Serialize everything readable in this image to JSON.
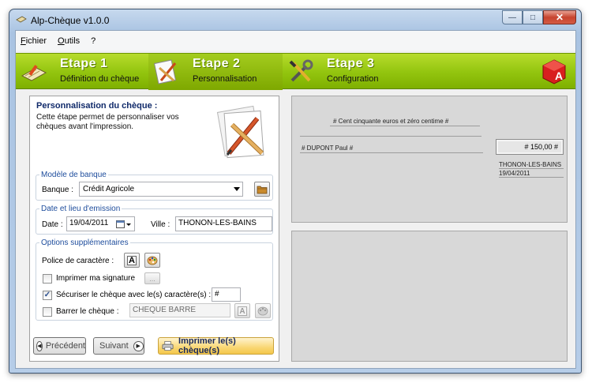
{
  "window": {
    "title": "Alp-Chèque v1.0.0"
  },
  "menu": [
    "Fichier",
    "Outils",
    "?"
  ],
  "steps": [
    {
      "title": "Etape 1",
      "subtitle": "Définition du chèque"
    },
    {
      "title": "Etape 2",
      "subtitle": "Personnalisation"
    },
    {
      "title": "Etape 3",
      "subtitle": "Configuration"
    }
  ],
  "panel": {
    "title": "Personnalisation du chèque :",
    "description": "Cette étape permet de personnaliser vos chèques avant l'impression."
  },
  "bank": {
    "legend": "Modèle de banque",
    "label": "Banque :",
    "value": "Crédit Agricole"
  },
  "date_place": {
    "legend": "Date et lieu d'emission",
    "date_label": "Date :",
    "date_value": "19/04/2011",
    "city_label": "Ville :",
    "city_value": "THONON-LES-BAINS"
  },
  "options": {
    "legend": "Options supplémentaires",
    "font_label": "Police de caractère :",
    "signature_label": "Imprimer ma signature",
    "signature_checked": false,
    "secure_label": "Sécuriser le chèque avec le(s) caractère(s) :",
    "secure_checked": true,
    "secure_char": "#",
    "cross_label": "Barrer le chèque :",
    "cross_checked": false,
    "cross_value": "CHEQUE BARRE"
  },
  "buttons": {
    "previous": "Précédent",
    "next": "Suivant",
    "print": "Imprimer le(s) chèque(s)"
  },
  "preview": {
    "amount_words": "# Cent cinquante euros et zéro centime  #",
    "payee": "# DUPONT Paul #",
    "amount": "# 150,00 #",
    "city": "THONON-LES-BAINS",
    "date": "19/04/2011"
  },
  "colors": {
    "accent_green": "#92c40e",
    "title_blue": "#102a6a",
    "legend_blue": "#1d4c9c"
  }
}
